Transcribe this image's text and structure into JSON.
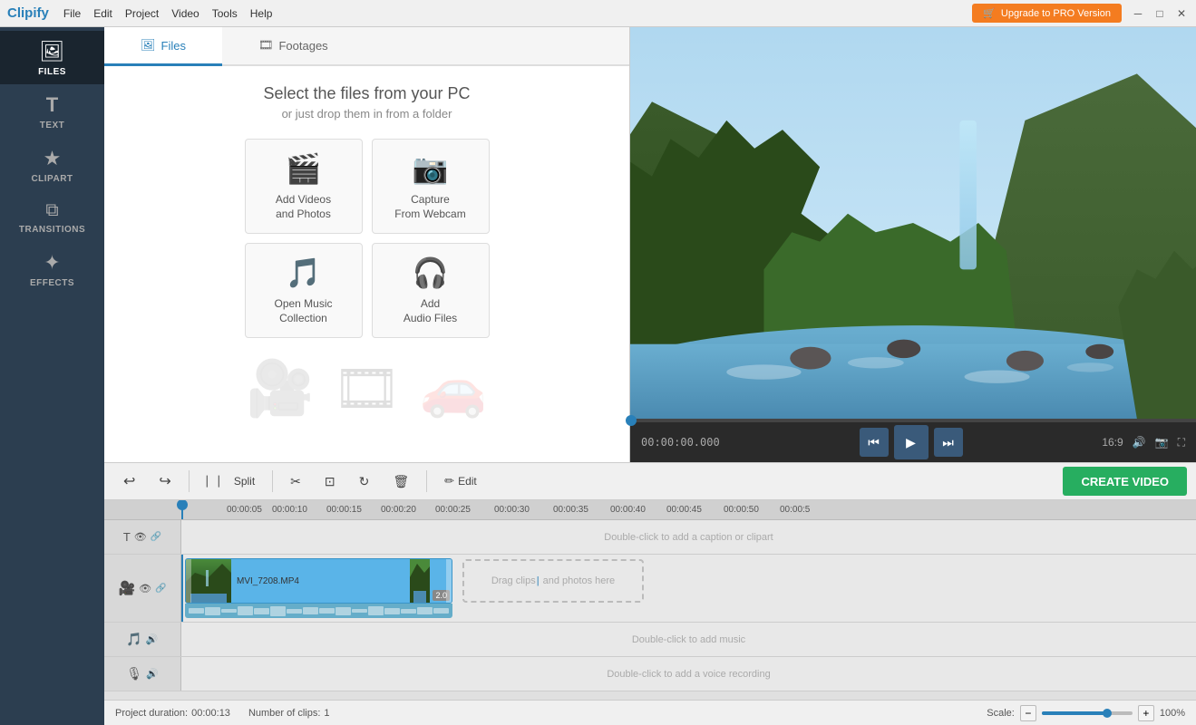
{
  "app": {
    "name": "Clipify",
    "upgrade_label": "Upgrade to PRO Version"
  },
  "menubar": {
    "items": [
      "File",
      "Edit",
      "Project",
      "Video",
      "Tools",
      "Help"
    ]
  },
  "window_controls": {
    "minimize": "─",
    "maximize": "□",
    "close": "✕"
  },
  "sidebar": {
    "items": [
      {
        "id": "files",
        "label": "FILES",
        "icon": "🖼",
        "active": true
      },
      {
        "id": "text",
        "label": "TEXT",
        "icon": "T",
        "active": false
      },
      {
        "id": "clipart",
        "label": "CLIPART",
        "icon": "★",
        "active": false
      },
      {
        "id": "transitions",
        "label": "TRANSITIONS",
        "icon": "⧉",
        "active": false
      },
      {
        "id": "effects",
        "label": "EFFECTS",
        "icon": "✦",
        "active": false
      }
    ]
  },
  "files_panel": {
    "tab_files": "Files",
    "tab_footages": "Footages",
    "heading": "Select the files from your PC",
    "subheading": "or just drop them in from a folder",
    "buttons": [
      {
        "id": "add-videos",
        "label": "Add Videos\nand Photos",
        "icon": "🎬"
      },
      {
        "id": "capture-webcam",
        "label": "Capture\nFrom Webcam",
        "icon": "📷"
      },
      {
        "id": "open-music",
        "label": "Open Music\nCollection",
        "icon": "🎵"
      },
      {
        "id": "add-audio",
        "label": "Add\nAudio Files",
        "icon": "🎧"
      }
    ]
  },
  "video_controls": {
    "time": "00:00:00.000",
    "aspect": "16:9",
    "prev_icon": "⏮",
    "play_icon": "▶",
    "next_icon": "⏭",
    "volume_icon": "🔊",
    "screenshot_icon": "📷",
    "fullscreen_icon": "⛶"
  },
  "toolbar": {
    "undo": "↩",
    "redo": "↪",
    "split_label": "Split",
    "cut_icon": "✂",
    "crop_icon": "⊡",
    "rotate_icon": "↻",
    "delete_icon": "🗑",
    "edit_label": "Edit",
    "create_video_label": "CREATE VIDEO"
  },
  "timeline": {
    "ruler_ticks": [
      "00:00:05",
      "00:00:10",
      "00:00:15",
      "00:00:20",
      "00:00:25",
      "00:00:30",
      "00:00:35",
      "00:00:40",
      "00:00:45",
      "00:00:50",
      "00:00:5"
    ],
    "caption_hint": "Double-click to add a caption or clipart",
    "clip_label": "MVI_7208.MP4",
    "clip_duration": "2.0",
    "drag_hint": "Drag clips | and photos here",
    "music_hint": "Double-click to add music",
    "voice_hint": "Double-click to add a voice recording"
  },
  "status_bar": {
    "duration_label": "Project duration:",
    "duration_value": "00:00:13",
    "clips_label": "Number of clips:",
    "clips_value": "1",
    "scale_label": "Scale:",
    "scale_pct": "100%"
  }
}
